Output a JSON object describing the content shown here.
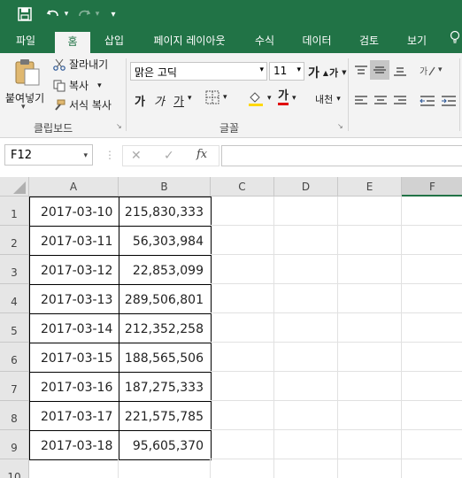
{
  "qat": {
    "save": "save-icon",
    "undo": "undo-icon",
    "redo": "redo-icon",
    "customize": "▾"
  },
  "tabs": [
    "파일",
    "홈",
    "삽입",
    "페이지 레이아웃",
    "수식",
    "데이터",
    "검토",
    "보기"
  ],
  "clipboard": {
    "paste": "붙여넣기",
    "cut": "잘라내기",
    "copy": "복사",
    "format_painter": "서식 복사",
    "group": "클립보드"
  },
  "font": {
    "name": "맑은 고딕",
    "size": "11",
    "bold": "가",
    "italic": "가",
    "underline": "가",
    "font_color_glyph": "가",
    "phonetic": "내천",
    "grow": "가",
    "shrink": "가",
    "group": "글꼴"
  },
  "formula_bar": {
    "name_box": "F12",
    "cancel": "✕",
    "enter": "✓",
    "fx": "fx",
    "value": ""
  },
  "sheet": {
    "columns": [
      "A",
      "B",
      "C",
      "D",
      "E",
      "F"
    ],
    "rows": [
      {
        "num": "1",
        "date": "2017-03-10",
        "value": "215,830,333"
      },
      {
        "num": "2",
        "date": "2017-03-11",
        "value": "56,303,984"
      },
      {
        "num": "3",
        "date": "2017-03-12",
        "value": "22,853,099"
      },
      {
        "num": "4",
        "date": "2017-03-13",
        "value": "289,506,801"
      },
      {
        "num": "5",
        "date": "2017-03-14",
        "value": "212,352,258"
      },
      {
        "num": "6",
        "date": "2017-03-15",
        "value": "188,565,506"
      },
      {
        "num": "7",
        "date": "2017-03-16",
        "value": "187,275,333"
      },
      {
        "num": "8",
        "date": "2017-03-17",
        "value": "221,575,785"
      },
      {
        "num": "9",
        "date": "2017-03-18",
        "value": "95,605,370"
      },
      {
        "num": "10",
        "date": "",
        "value": ""
      }
    ]
  },
  "colors": {
    "brand": "#217346",
    "selected_column": "#d2d2d2",
    "grid": "#e1e1e1"
  }
}
